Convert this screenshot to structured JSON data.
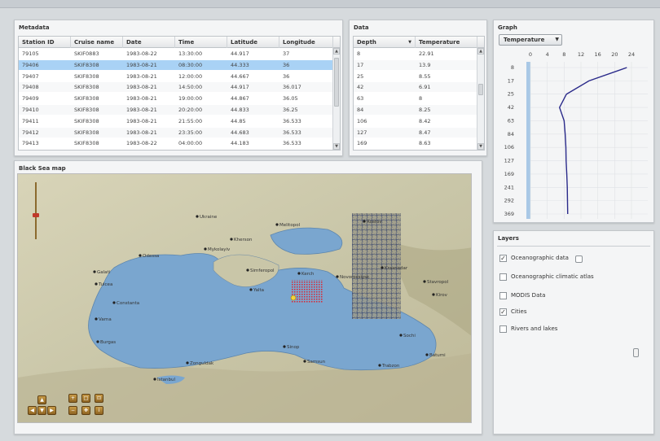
{
  "metadata": {
    "title": "Metadata",
    "columns": [
      "Station ID",
      "Cruise name",
      "Date",
      "Time",
      "Latitude",
      "Longitude"
    ],
    "rows": [
      [
        "79105",
        "SKIF0883",
        "1983-08-22",
        "13:30:00",
        "44.917",
        "37"
      ],
      [
        "79406",
        "SKIF8308",
        "1983-08-21",
        "08:30:00",
        "44.333",
        "36"
      ],
      [
        "79407",
        "SKIF8308",
        "1983-08-21",
        "12:00:00",
        "44.667",
        "36"
      ],
      [
        "79408",
        "SKIF8308",
        "1983-08-21",
        "14:50:00",
        "44.917",
        "36.017"
      ],
      [
        "79409",
        "SKIF8308",
        "1983-08-21",
        "19:00:00",
        "44.867",
        "36.05"
      ],
      [
        "79410",
        "SKIF8308",
        "1983-08-21",
        "20:20:00",
        "44.833",
        "36.25"
      ],
      [
        "79411",
        "SKIF8308",
        "1983-08-21",
        "21:55:00",
        "44.85",
        "36.533"
      ],
      [
        "79412",
        "SKIF8308",
        "1983-08-21",
        "23:35:00",
        "44.683",
        "36.533"
      ],
      [
        "79413",
        "SKIF8308",
        "1983-08-22",
        "04:00:00",
        "44.183",
        "36.533"
      ]
    ],
    "selected_row": 1
  },
  "data_panel": {
    "title": "Data",
    "columns": [
      "Depth",
      "Temperature"
    ],
    "sort_icon": "sort-desc-icon",
    "rows": [
      [
        "8",
        "22.91"
      ],
      [
        "17",
        "13.9"
      ],
      [
        "25",
        "8.55"
      ],
      [
        "42",
        "6.91"
      ],
      [
        "63",
        "8"
      ],
      [
        "84",
        "8.25"
      ],
      [
        "106",
        "8.42"
      ],
      [
        "127",
        "8.47"
      ],
      [
        "169",
        "8.63"
      ]
    ]
  },
  "graph": {
    "title": "Graph",
    "dropdown_value": "Temperature",
    "dropdown_icon": "chevron-down-icon"
  },
  "chart_data": {
    "type": "line",
    "x_ticks": [
      0,
      4,
      8,
      12,
      16,
      20,
      24
    ],
    "y_ticks": [
      "8",
      "17",
      "25",
      "42",
      "63",
      "84",
      "106",
      "127",
      "169",
      "241",
      "292",
      "369"
    ],
    "xlim": [
      0,
      24
    ],
    "series": [
      {
        "color": "#2a2a8a",
        "points": [
          {
            "depth": 8,
            "value": 22.9
          },
          {
            "depth": 17,
            "value": 13.9
          },
          {
            "depth": 25,
            "value": 8.55
          },
          {
            "depth": 42,
            "value": 6.91
          },
          {
            "depth": 63,
            "value": 8.0
          },
          {
            "depth": 84,
            "value": 8.25
          },
          {
            "depth": 106,
            "value": 8.42
          },
          {
            "depth": 127,
            "value": 8.47
          },
          {
            "depth": 169,
            "value": 8.63
          },
          {
            "depth": 241,
            "value": 8.75
          },
          {
            "depth": 292,
            "value": 8.8
          },
          {
            "depth": 369,
            "value": 8.85
          }
        ]
      }
    ],
    "grid": true
  },
  "map": {
    "title": "Black Sea map",
    "labels": [
      {
        "id": "ukraine",
        "text": "Ukraine"
      },
      {
        "id": "cities_north",
        "text": "Odessa"
      },
      {
        "id": "city2",
        "text": "Mykolayiv"
      },
      {
        "id": "city3",
        "text": "Kherson"
      },
      {
        "id": "city4",
        "text": "Melitopol"
      },
      {
        "id": "city5",
        "text": "Simferopol"
      },
      {
        "id": "city6",
        "text": "Yalta"
      },
      {
        "id": "city7",
        "text": "Kerch"
      },
      {
        "id": "city8",
        "text": "Novorossiysk"
      },
      {
        "id": "city9",
        "text": "Varna"
      },
      {
        "id": "city10",
        "text": "Burgas"
      },
      {
        "id": "city11",
        "text": "Istanbul"
      },
      {
        "id": "city12",
        "text": "Sinop"
      },
      {
        "id": "city13",
        "text": "Samsun"
      },
      {
        "id": "city14",
        "text": "Trabzon"
      },
      {
        "id": "city15",
        "text": "Constanta"
      },
      {
        "id": "city16",
        "text": "Sochi"
      },
      {
        "id": "city17",
        "text": "Zonguldak"
      },
      {
        "id": "city18",
        "text": "Batumi"
      },
      {
        "id": "city19",
        "text": "Rostov"
      },
      {
        "id": "city20",
        "text": "Krasnodar"
      },
      {
        "id": "city21",
        "text": "Stavropol"
      },
      {
        "id": "city22",
        "text": "Kirov"
      },
      {
        "id": "city23",
        "text": "Tulcea"
      },
      {
        "id": "city24",
        "text": "Galati"
      }
    ]
  },
  "layers": {
    "title": "Layers",
    "items": [
      {
        "label": "Oceanographic data",
        "checked": true
      },
      {
        "label": "Oceanographic climatic atlas",
        "checked": false
      },
      {
        "label": "MODIS Data",
        "checked": false
      },
      {
        "label": "Cities",
        "checked": true
      },
      {
        "label": "Rivers and lakes",
        "checked": false
      }
    ]
  }
}
